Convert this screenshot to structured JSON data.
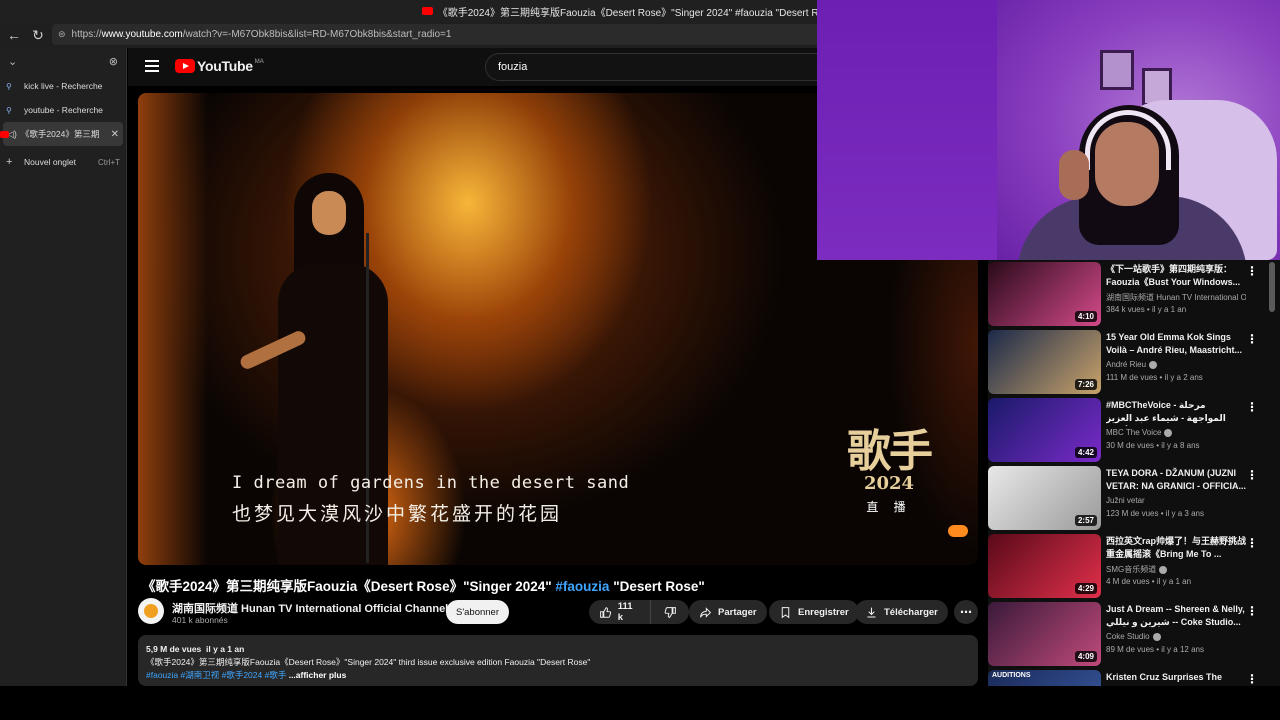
{
  "browser": {
    "window_title": "《歌手2024》第三期纯享版Faouzia《Desert Rose》\"Singer 2024\" #faouzia \"Desert Rose\" - Yo",
    "url_prefix": "https://",
    "url_host": "www.youtube.com",
    "url_path": "/watch?v=-M67Obk8bis&list=RD-M67Obk8bis&start_radio=1",
    "tabs": [
      {
        "label": "kick live - Recherche",
        "icon": "search-icon"
      },
      {
        "label": "youtube - Recherche",
        "icon": "search-icon"
      },
      {
        "label": "《歌手2024》第三期",
        "icon": "youtube-icon",
        "active": true
      },
      {
        "label": "Nouvel onglet",
        "shortcut": "Ctrl+T",
        "icon": "plus-icon"
      }
    ]
  },
  "youtube": {
    "logo_text": "YouTube",
    "country_code": "MA",
    "search_value": "fouzia"
  },
  "video": {
    "caption_en": "I dream of gardens in the desert sand",
    "caption_zh": "也梦见大漠风沙中繁花盛开的花园",
    "show_logo_zh": "歌手",
    "show_logo_year": "2024",
    "show_logo_live": "直 播",
    "title_main": "《歌手2024》第三期纯享版Faouzia《Desert Rose》\"Singer 2024\" ",
    "title_hashtag": "#faouzia",
    "title_end": " \"Desert Rose\""
  },
  "channel": {
    "name": "湖南国际频道 Hunan TV International  Official Channel",
    "subscribers": "401 k abonnés",
    "subscribe_label": "S'abonner"
  },
  "actions": {
    "likes": "111 k",
    "share": "Partager",
    "save": "Enregistrer",
    "download": "Télécharger",
    "more": "⋯"
  },
  "description": {
    "views": "5,9 M de vues",
    "age": "il y a 1 an",
    "text": "《歌手2024》第三期纯享版Faouzia《Desert Rose》\"Singer 2024\" third issue exclusive edition Faouzia \"Desert Rose\"",
    "tags": "#faouzia #湖南卫视 #歌手2024 #歌手",
    "more_label": "...afficher plus"
  },
  "recommendations": [
    {
      "title": "《下一站歌手》第四期纯享版：Faouzia《Bust Your Windows...",
      "channel": "湖南国际频道 Hunan TV International O...",
      "views": "384 k vues",
      "age": "il y a 1 an",
      "duration": "4:10",
      "verified": false,
      "c1": "#2a0a1a",
      "c2": "#d34a8a"
    },
    {
      "title": "15 Year Old Emma Kok Sings Voilà – André Rieu, Maastricht...",
      "channel": "André Rieu",
      "views": "111 M de vues",
      "age": "il y a 2 ans",
      "duration": "7:26",
      "verified": true,
      "c1": "#1b2a4a",
      "c2": "#c9a36a"
    },
    {
      "title": "#MBCTheVoice - مرحلة المواجهة - شيماء عبد العزيز وهالة مالكي تقدمان أغنية",
      "channel": "MBC The Voice",
      "views": "30 M de vues",
      "age": "il y a 8 ans",
      "duration": "4:42",
      "verified": true,
      "c1": "#1a1a6a",
      "c2": "#7a2ac8"
    },
    {
      "title": "TEYA DORA - DŽANUM (JUZNI VETAR: NA GRANICI - OFFICIA...",
      "channel": "Južni vetar",
      "views": "123 M de vues",
      "age": "il y a 3 ans",
      "duration": "2:57",
      "verified": false,
      "c1": "#e8e8e8",
      "c2": "#9a9a9a"
    },
    {
      "title": "西拉英文rap帅爆了！与王赫野挑战重金属摇滚《Bring Me To ...",
      "channel": "SMG音乐频道",
      "views": "4 M de vues",
      "age": "il y a 1 an",
      "duration": "4:29",
      "verified": true,
      "c1": "#5a0a1a",
      "c2": "#e0304a"
    },
    {
      "title": "Just A Dream -- Shereen & Nelly, شيرين و نيللي -- Coke Studio...",
      "channel": "Coke Studio",
      "views": "89 M de vues",
      "age": "il y a 12 ans",
      "duration": "4:09",
      "verified": true,
      "c1": "#3a1a3a",
      "c2": "#c04a7a"
    },
    {
      "title": "Kristen Cruz Surprises The",
      "channel": "",
      "views": "",
      "age": "",
      "duration": "",
      "verified": false,
      "thumb_label": "AUDITIONS",
      "c1": "#1a2a5a",
      "c2": "#3a5aa0"
    }
  ]
}
